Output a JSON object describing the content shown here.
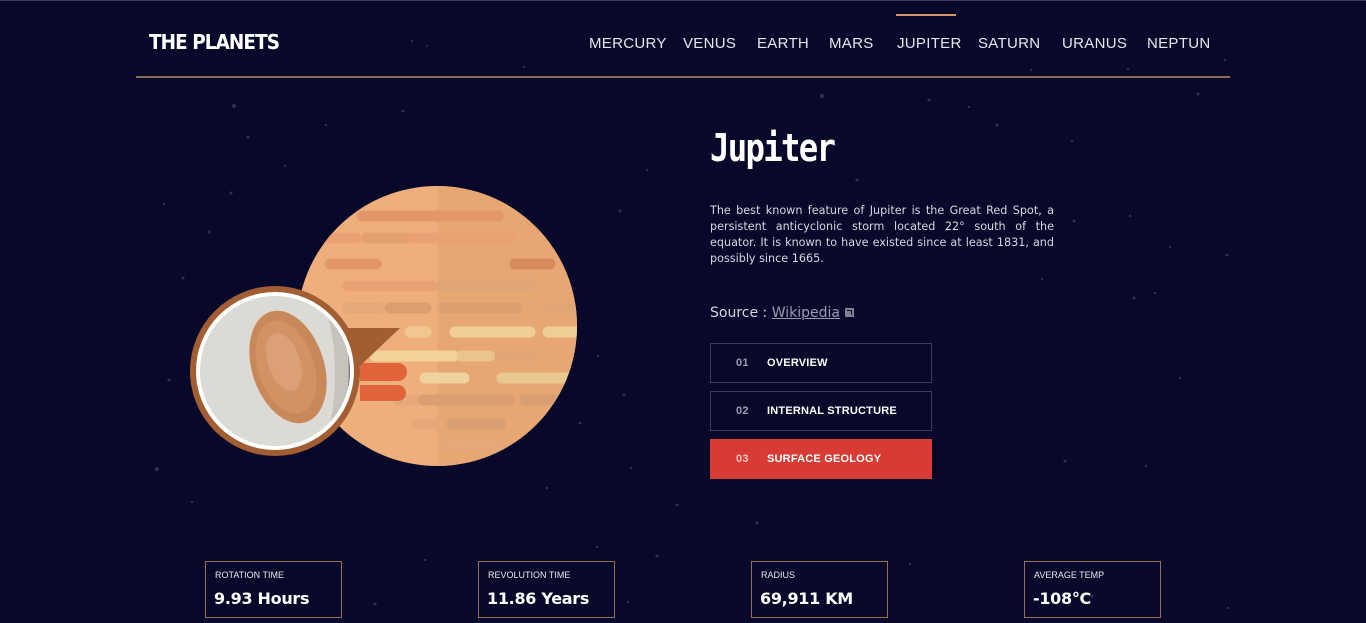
{
  "app": {
    "logo": "THE PLANETS"
  },
  "nav": {
    "items": [
      {
        "label": "MERCURY"
      },
      {
        "label": "VENUS"
      },
      {
        "label": "EARTH"
      },
      {
        "label": "MARS"
      },
      {
        "label": "JUPITER",
        "active": true
      },
      {
        "label": "SATURN"
      },
      {
        "label": "URANUS"
      },
      {
        "label": "NEPTUN"
      }
    ]
  },
  "planet": {
    "name": "Jupiter",
    "description": "The best known feature of Jupiter is the Great Red Spot, a persistent anticyclonic storm located 22° south of the equator. It is known to have existed since at least 1831, and possibly since 1665.",
    "source_prefix": "Source : ",
    "source_link": "Wikipedia",
    "source_icon": "external-link-icon"
  },
  "tabs": [
    {
      "num": "01",
      "label": "OVERVIEW",
      "active": false
    },
    {
      "num": "02",
      "label": "INTERNAL STRUCTURE",
      "active": false
    },
    {
      "num": "03",
      "label": "SURFACE GEOLOGY",
      "active": true
    }
  ],
  "stats": [
    {
      "label": "ROTATION TIME",
      "value": "9.93 Hours"
    },
    {
      "label": "REVOLUTION TIME",
      "value": "11.86 Years"
    },
    {
      "label": "RADIUS",
      "value": "69,911 KM"
    },
    {
      "label": "AVERAGE TEMP",
      "value": "-108°C"
    }
  ],
  "colors": {
    "background": "#08082a",
    "accent_active": "#d83a34",
    "stat_border": "#9c6c50",
    "nav_indicator": "#d8956a",
    "planet_base": "#eeaf7c"
  }
}
